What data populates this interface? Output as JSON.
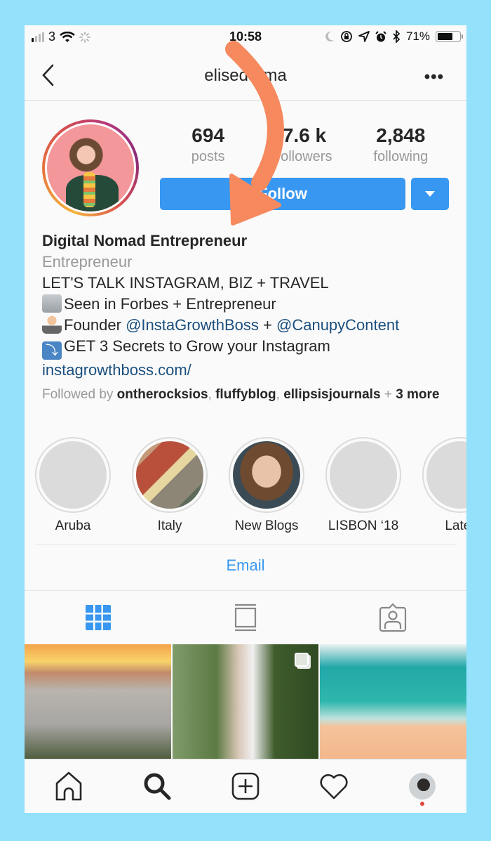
{
  "status_bar": {
    "carrier": "3",
    "time": "10:58",
    "battery_percent": "71%",
    "battery_level": 0.71,
    "icons": [
      "signal-icon",
      "wifi-icon",
      "loading-icon",
      "moon-icon",
      "rotation-lock-icon",
      "location-icon",
      "alarm-icon",
      "bluetooth-icon",
      "battery-icon"
    ]
  },
  "nav": {
    "title": "elisedarma",
    "back_icon": "chevron-left-icon",
    "more_icon": "more-horizontal-icon",
    "more_glyph": "•••"
  },
  "profile": {
    "stats": [
      {
        "value": "694",
        "label": "posts"
      },
      {
        "value": "7.6 k",
        "label": "followers"
      },
      {
        "value": "2,848",
        "label": "following"
      }
    ],
    "follow_label": "Follow",
    "dropdown_icon": "caret-down-icon"
  },
  "bio": {
    "name": "Digital Nomad Entrepreneur",
    "category": "Entrepreneur",
    "line1": "LET'S TALK INSTAGRAM, BIZ + TRAVEL",
    "line2": "Seen in Forbes + Entrepreneur",
    "line3_prefix": "Founder ",
    "mention1": "@InstaGrowthBoss",
    "line3_mid": " + ",
    "mention2": "@CanupyContent",
    "line4": "GET 3 Secrets to Grow your Instagram",
    "link": "instagrowthboss.com/",
    "followed_prefix": "Followed by ",
    "followed_users": [
      "ontherocksios",
      "fluffyblog",
      "ellipsisjournals"
    ],
    "followed_sep": ", ",
    "followed_plus": " + ",
    "followed_more": "3 more",
    "emoji_down": "⤵"
  },
  "highlights": [
    {
      "label": "Aruba"
    },
    {
      "label": "Italy"
    },
    {
      "label": "New Blogs"
    },
    {
      "label": "LISBON ‘18"
    },
    {
      "label": "Later"
    }
  ],
  "email_label": "Email",
  "tabs": [
    {
      "name": "grid",
      "icon": "grid-icon",
      "active": true
    },
    {
      "name": "feed",
      "icon": "list-feed-icon",
      "active": false
    },
    {
      "name": "tagged",
      "icon": "tagged-person-icon",
      "active": false
    }
  ],
  "bottom_nav": [
    "home-icon",
    "search-icon",
    "add-post-icon",
    "heart-icon",
    "profile-avatar"
  ],
  "colors": {
    "accent": "#3897f0",
    "mention": "#1b4f7e",
    "background_frame": "#93e1fb",
    "annotation_arrow": "#f7895f",
    "notification_dot": "#e0463c"
  }
}
